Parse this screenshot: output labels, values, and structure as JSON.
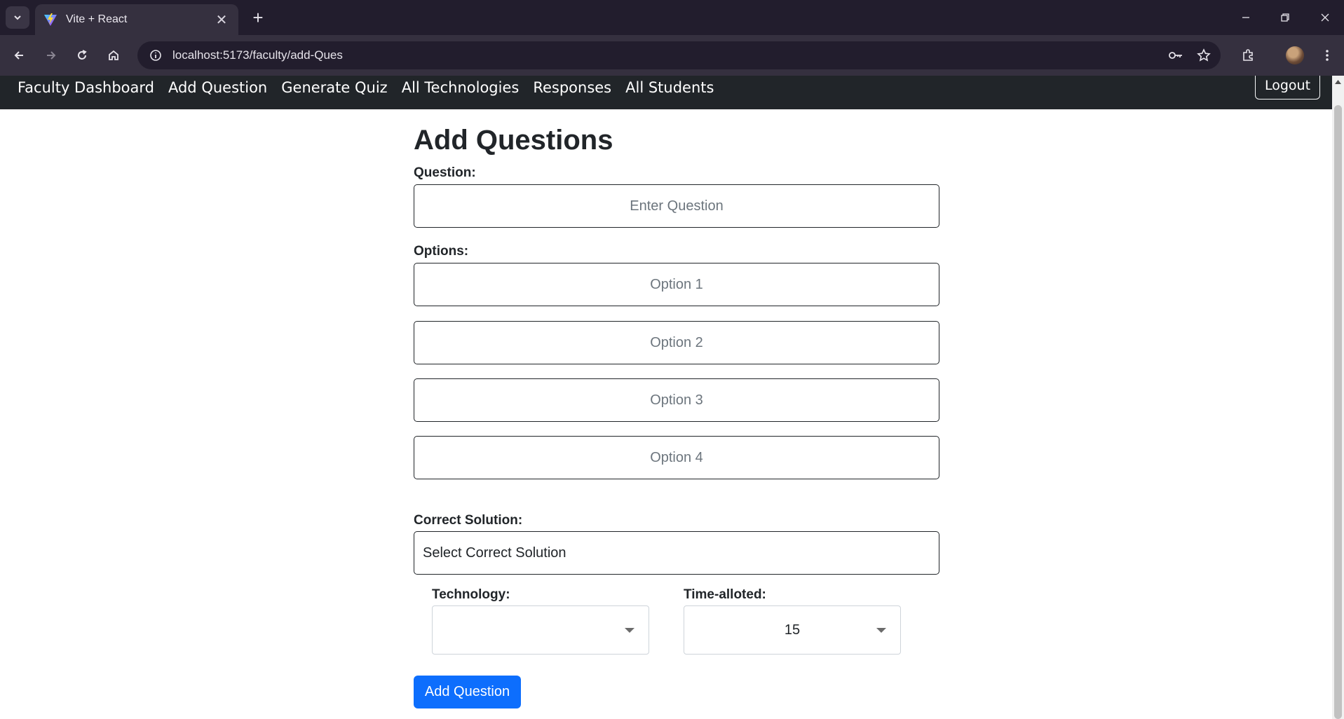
{
  "browser": {
    "tab_title": "Vite + React",
    "url": "localhost:5173/faculty/add-Ques"
  },
  "nav": {
    "links": [
      "Faculty Dashboard",
      "Add Question",
      "Generate Quiz",
      "All Technologies",
      "Responses",
      "All Students"
    ],
    "logout_label": "Logout"
  },
  "form": {
    "heading": "Add Questions",
    "question_label": "Question:",
    "question_placeholder": "Enter Question",
    "options_label": "Options:",
    "option_placeholders": [
      "Option 1",
      "Option 2",
      "Option 3",
      "Option 4"
    ],
    "correct_label": "Correct Solution:",
    "correct_value": "Select Correct Solution",
    "technology_label": "Technology:",
    "technology_value": "",
    "time_label": "Time-alloted:",
    "time_value": "15",
    "submit_label": "Add Question"
  },
  "colors": {
    "primary": "#0d6efd",
    "navbar": "#212529",
    "chrome_dark": "#221d2d",
    "chrome_toolbar": "#35303f"
  }
}
